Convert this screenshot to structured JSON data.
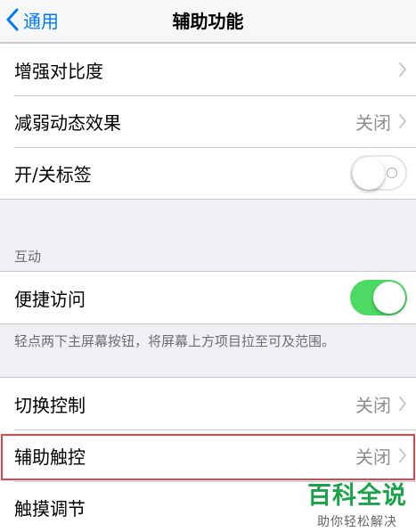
{
  "nav": {
    "back_label": "通用",
    "title": "辅助功能"
  },
  "group1": [
    {
      "label": "增强对比度",
      "value": ""
    },
    {
      "label": "减弱动态效果",
      "value": "关闭"
    },
    {
      "label": "开/关标签",
      "toggle": "off"
    }
  ],
  "interaction": {
    "header": "互动",
    "reachability_label": "便捷访问",
    "reachability_state": "on",
    "footer": "轻点两下主屏幕按钮，将屏幕上方项目拉至可及范围。"
  },
  "group3": [
    {
      "label": "切换控制",
      "value": "关闭"
    },
    {
      "label": "辅助触控",
      "value": "关闭"
    },
    {
      "label": "触摸调节",
      "value": ""
    }
  ],
  "watermark": {
    "title": "百科全说",
    "subtitle": "助你轻松解决"
  },
  "colors": {
    "accent": "#007aff",
    "toggle_on": "#4cd964",
    "highlight": "#e0434a",
    "watermark": "#1aa34a"
  }
}
